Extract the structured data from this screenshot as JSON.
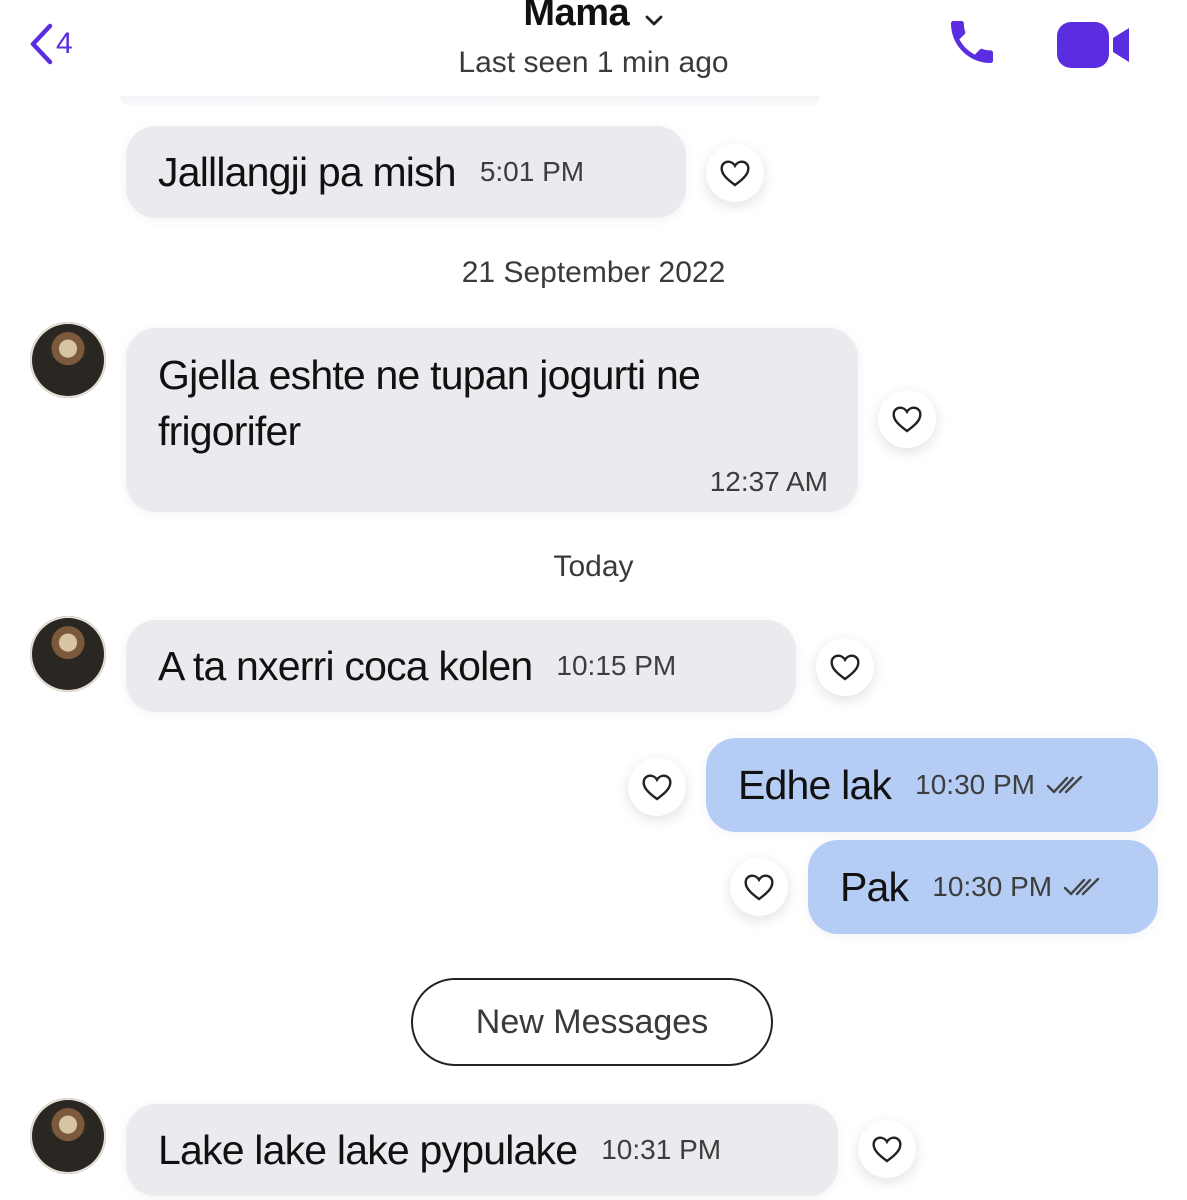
{
  "header": {
    "back_count": "4",
    "contact_name": "Mama",
    "status": "Last seen 1 min ago",
    "accent_color": "#5a2ee0"
  },
  "messages": [
    {
      "direction": "in",
      "text": "Jalllangji pa mish",
      "time": "5:01 PM"
    },
    {
      "direction": "in",
      "text_line1": "Gjella eshte ne tupan jogurti ne",
      "text_line2": "frigorifer",
      "time": "12:37 AM"
    },
    {
      "direction": "in",
      "text": "A ta nxerri coca kolen",
      "time": "10:15 PM"
    },
    {
      "direction": "out",
      "text": "Edhe lak",
      "time": "10:30 PM",
      "status_icon": "double-check-icon"
    },
    {
      "direction": "out",
      "text": "Pak",
      "time": "10:30 PM",
      "status_icon": "double-check-icon"
    },
    {
      "direction": "in",
      "text": "Lake lake lake pypulake",
      "time": "10:31 PM"
    }
  ],
  "separators": {
    "date1": "21 September 2022",
    "date2": "Today",
    "new_messages": "New Messages"
  },
  "colors": {
    "incoming_bubble": "#ebebef",
    "outgoing_bubble": "#b5ccf5"
  }
}
